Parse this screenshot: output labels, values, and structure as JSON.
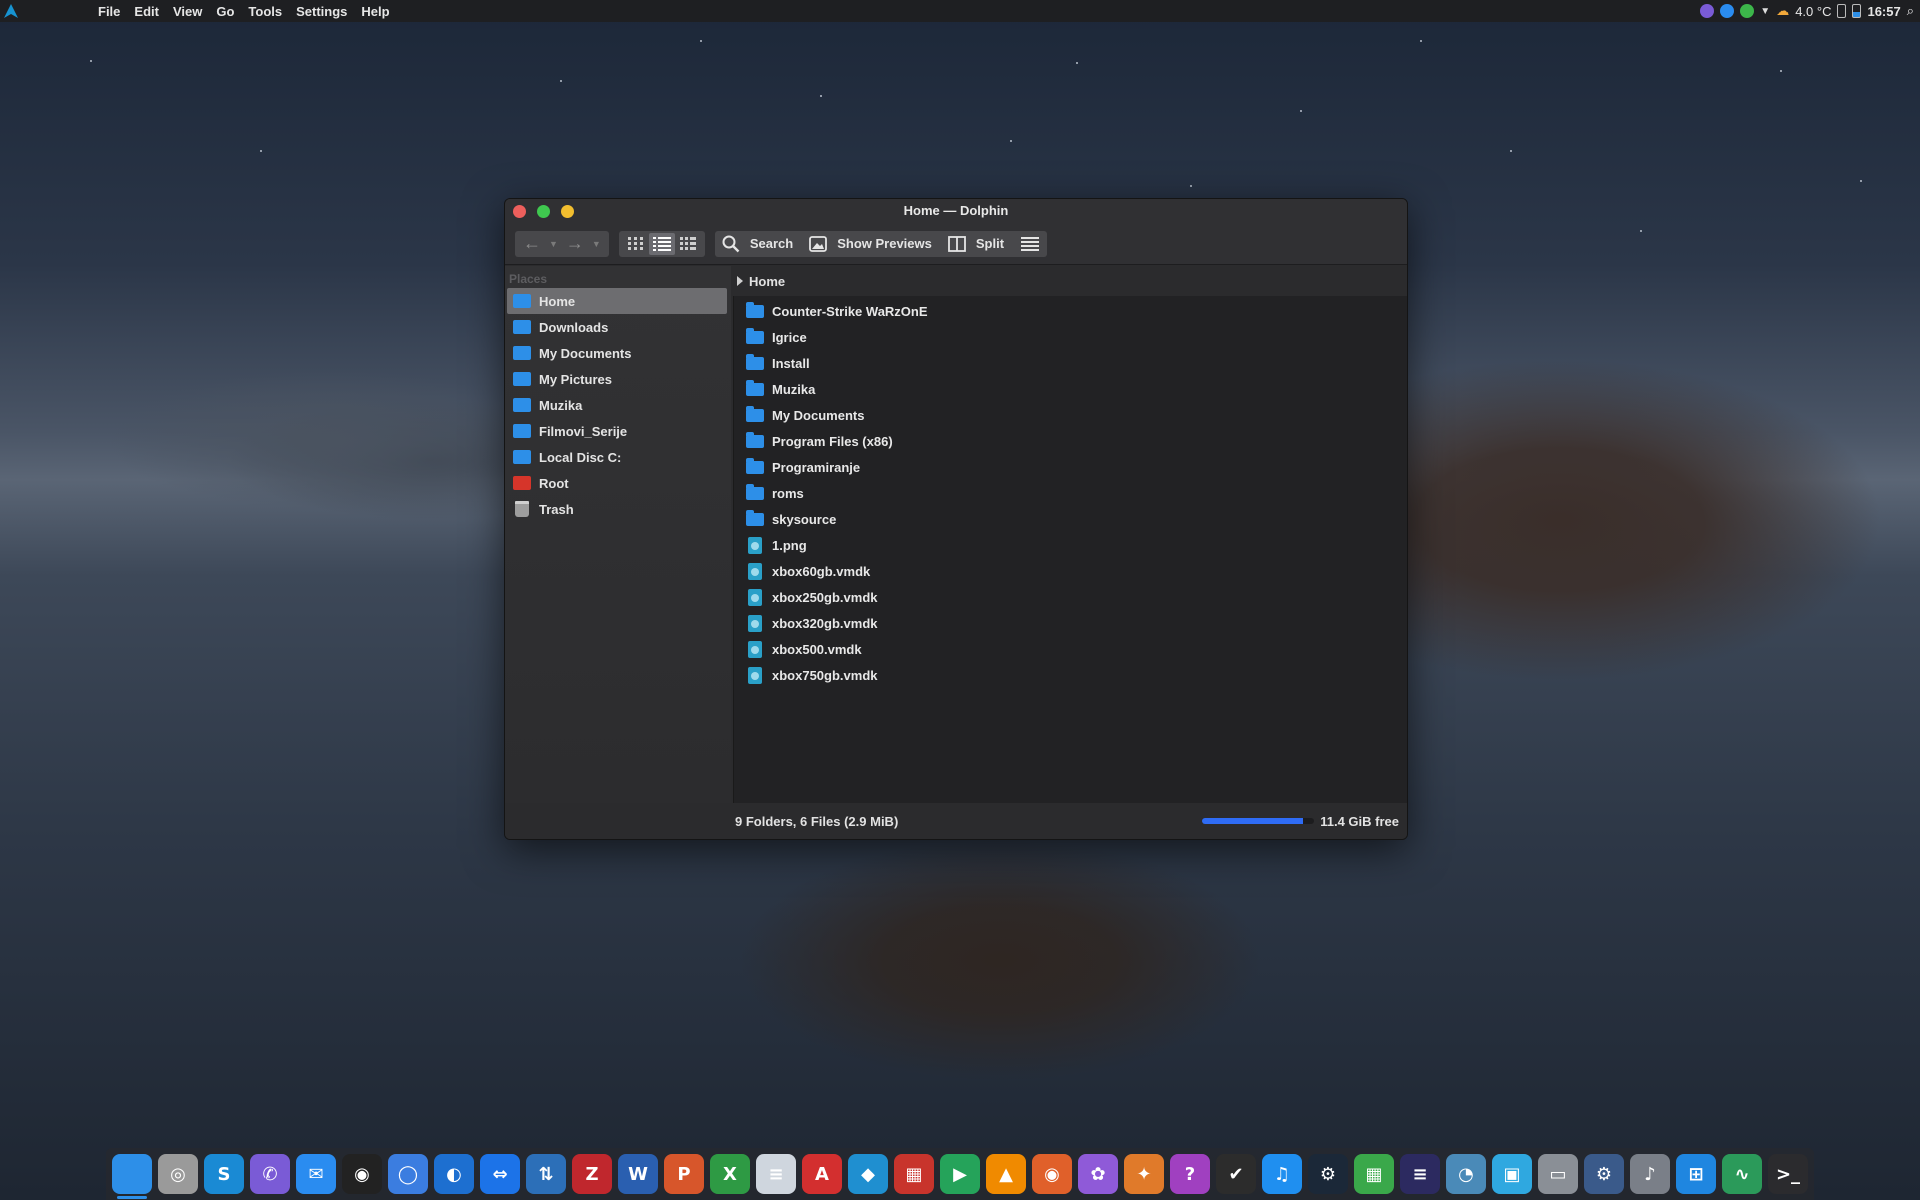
{
  "top_panel": {
    "menu": [
      "File",
      "Edit",
      "View",
      "Go",
      "Tools",
      "Settings",
      "Help"
    ],
    "weather": "4.0 °C",
    "clock": "16:57"
  },
  "window": {
    "title": "Home — Dolphin",
    "toolbar": {
      "search_label": "Search",
      "previews_label": "Show Previews",
      "split_label": "Split"
    },
    "places": {
      "title": "Places",
      "items": [
        {
          "label": "Home",
          "icon": "home-folder-icon",
          "color": "#2d8fe8"
        },
        {
          "label": "Downloads",
          "icon": "folder-icon",
          "color": "#2d8fe8"
        },
        {
          "label": "My Documents",
          "icon": "folder-icon",
          "color": "#2d8fe8"
        },
        {
          "label": "My Pictures",
          "icon": "folder-icon",
          "color": "#2d8fe8"
        },
        {
          "label": "Muzika",
          "icon": "folder-icon",
          "color": "#2d8fe8"
        },
        {
          "label": "Filmovi_Serije",
          "icon": "folder-icon",
          "color": "#2d8fe8"
        },
        {
          "label": "Local Disc C:",
          "icon": "folder-icon",
          "color": "#2d8fe8"
        },
        {
          "label": "Root",
          "icon": "root-folder-icon",
          "color": "#d6352a"
        },
        {
          "label": "Trash",
          "icon": "trash-icon",
          "color": "#a8a8a8"
        }
      ]
    },
    "breadcrumb": "Home",
    "files": [
      {
        "name": "Counter-Strike WaRzOnE",
        "type": "folder"
      },
      {
        "name": "Igrice",
        "type": "folder"
      },
      {
        "name": "Install",
        "type": "folder"
      },
      {
        "name": "Muzika",
        "type": "folder"
      },
      {
        "name": "My Documents",
        "type": "folder"
      },
      {
        "name": "Program Files (x86)",
        "type": "folder"
      },
      {
        "name": "Programiranje",
        "type": "folder"
      },
      {
        "name": "roms",
        "type": "folder"
      },
      {
        "name": "skysource",
        "type": "folder"
      },
      {
        "name": "1.png",
        "type": "file"
      },
      {
        "name": "xbox60gb.vmdk",
        "type": "file"
      },
      {
        "name": "xbox250gb.vmdk",
        "type": "file"
      },
      {
        "name": "xbox320gb.vmdk",
        "type": "file"
      },
      {
        "name": "xbox500.vmdk",
        "type": "file"
      },
      {
        "name": "xbox750gb.vmdk",
        "type": "file"
      }
    ],
    "status": {
      "summary": "9 Folders, 6 Files (2.9 MiB)",
      "free": "11.4 GiB free",
      "used_fraction": 0.9
    }
  },
  "dock": {
    "items": [
      {
        "icon": "file-manager-icon",
        "color": "#2d8fe8",
        "glyph": ""
      },
      {
        "icon": "disk-utility-icon",
        "color": "#9a9a9a",
        "glyph": "◎"
      },
      {
        "icon": "skype-icon",
        "color": "#1a8ad4",
        "glyph": "S"
      },
      {
        "icon": "viber-icon",
        "color": "#7a5bd6",
        "glyph": "✆"
      },
      {
        "icon": "messenger-icon",
        "color": "#2a8cf0",
        "glyph": "✉"
      },
      {
        "icon": "camera-icon",
        "color": "#222222",
        "glyph": "◉"
      },
      {
        "icon": "chromium-icon",
        "color": "#3b7de0",
        "glyph": "◯"
      },
      {
        "icon": "browser-icon",
        "color": "#1d6fd0",
        "glyph": "◐"
      },
      {
        "icon": "teamviewer-icon",
        "color": "#1c73e8",
        "glyph": "⇔"
      },
      {
        "icon": "network-transfer-icon",
        "color": "#2c6fb8",
        "glyph": "⇅"
      },
      {
        "icon": "filezilla-icon",
        "color": "#c0272d",
        "glyph": "Z"
      },
      {
        "icon": "writer-icon",
        "color": "#2a5fb0",
        "glyph": "W"
      },
      {
        "icon": "impress-icon",
        "color": "#d7562b",
        "glyph": "P"
      },
      {
        "icon": "calc-icon",
        "color": "#2e9a44",
        "glyph": "X"
      },
      {
        "icon": "text-editor-icon",
        "color": "#cfd6de",
        "glyph": "≡"
      },
      {
        "icon": "pdf-reader-icon",
        "color": "#d32f2f",
        "glyph": "A"
      },
      {
        "icon": "kodi-icon",
        "color": "#1f8fd0",
        "glyph": "◆"
      },
      {
        "icon": "popcorn-icon",
        "color": "#c8342c",
        "glyph": "▦"
      },
      {
        "icon": "media-player-icon",
        "color": "#25a35a",
        "glyph": "▶"
      },
      {
        "icon": "vlc-icon",
        "color": "#f08a00",
        "glyph": "▲"
      },
      {
        "icon": "disc-burner-icon",
        "color": "#e0602a",
        "glyph": "◉"
      },
      {
        "icon": "paint-icon",
        "color": "#8f5ad8",
        "glyph": "✿"
      },
      {
        "icon": "gimp-icon",
        "color": "#e07a2a",
        "glyph": "✦"
      },
      {
        "icon": "fsearch-icon",
        "color": "#a040c0",
        "glyph": "?"
      },
      {
        "icon": "tasks-icon",
        "color": "#2c2c2c",
        "glyph": "✔"
      },
      {
        "icon": "music-icon",
        "color": "#1f8ff0",
        "glyph": "♫"
      },
      {
        "icon": "steam-icon",
        "color": "#1b2838",
        "glyph": "⚙"
      },
      {
        "icon": "grid-apps-icon",
        "color": "#3aa84a",
        "glyph": "▦"
      },
      {
        "icon": "eclipse-icon",
        "color": "#2c2a60",
        "glyph": "≡"
      },
      {
        "icon": "wireshark-icon",
        "color": "#4a8ab8",
        "glyph": "◔"
      },
      {
        "icon": "virtualbox-icon",
        "color": "#2fa8e0",
        "glyph": "▣"
      },
      {
        "icon": "remote-desktop-icon",
        "color": "#8a8f96",
        "glyph": "▭"
      },
      {
        "icon": "system-settings-icon",
        "color": "#3a5a8a",
        "glyph": "⚙"
      },
      {
        "icon": "audio-editor-icon",
        "color": "#7a7f88",
        "glyph": "♪"
      },
      {
        "icon": "windows-apps-icon",
        "color": "#1f86e0",
        "glyph": "⊞"
      },
      {
        "icon": "system-monitor-icon",
        "color": "#2b9a5a",
        "glyph": "∿"
      },
      {
        "icon": "terminal-icon",
        "color": "#2b2b2e",
        "glyph": ">_"
      }
    ]
  }
}
